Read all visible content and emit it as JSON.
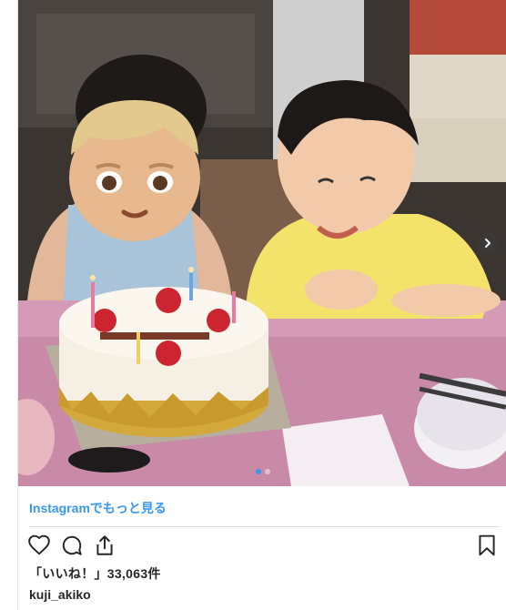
{
  "post": {
    "photo_alt": "childhood birthday photo",
    "more_link": "Instagramでもっと見る",
    "likes": "「いいね！」33,063件",
    "username": "kuji_akiko",
    "carousel": {
      "total": 2,
      "active": 1
    }
  },
  "icons": {
    "next": "chevron-right-icon",
    "like": "heart-icon",
    "comment": "comment-icon",
    "share": "share-icon",
    "save": "bookmark-icon",
    "face_sticker": "boy-face-emoji-icon"
  },
  "colors": {
    "link": "#3897f0",
    "text": "#262626",
    "divider": "#dbdbdb"
  }
}
